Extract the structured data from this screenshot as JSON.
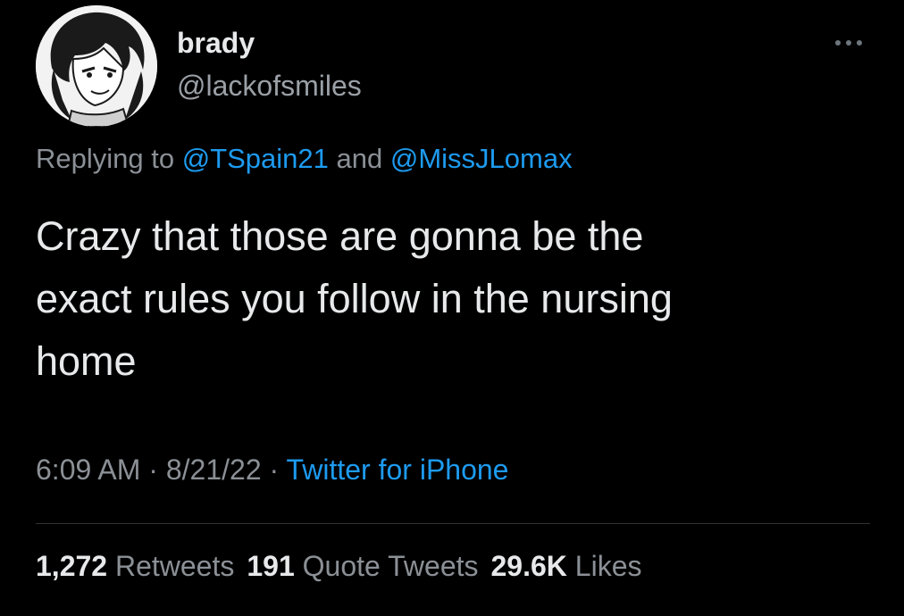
{
  "tweet": {
    "display_name": "brady",
    "handle": "@lackofsmiles",
    "avatar_icon": "anime-character-avatar",
    "more_icon": "more-options-icon",
    "reply": {
      "prefix": "Replying to ",
      "mention_1": "@TSpain21",
      "connector": " and ",
      "mention_2": "@MissJLomax"
    },
    "text": "Crazy that those are gonna be the\nexact rules you follow in the nursing\nhome",
    "time": "6:09 AM",
    "separator_1": " · ",
    "date": "8/21/22",
    "separator_2": " · ",
    "source": "Twitter for iPhone",
    "stats": {
      "retweets_count": "1,272",
      "retweets_label": " Retweets",
      "quotes_count": "191",
      "quotes_label": " Quote Tweets",
      "likes_count": "29.6K",
      "likes_label": " Likes"
    }
  },
  "colors": {
    "background": "#000000",
    "text_primary": "#e7e9ea",
    "text_secondary": "#8b9096",
    "link": "#1d9bf0"
  }
}
